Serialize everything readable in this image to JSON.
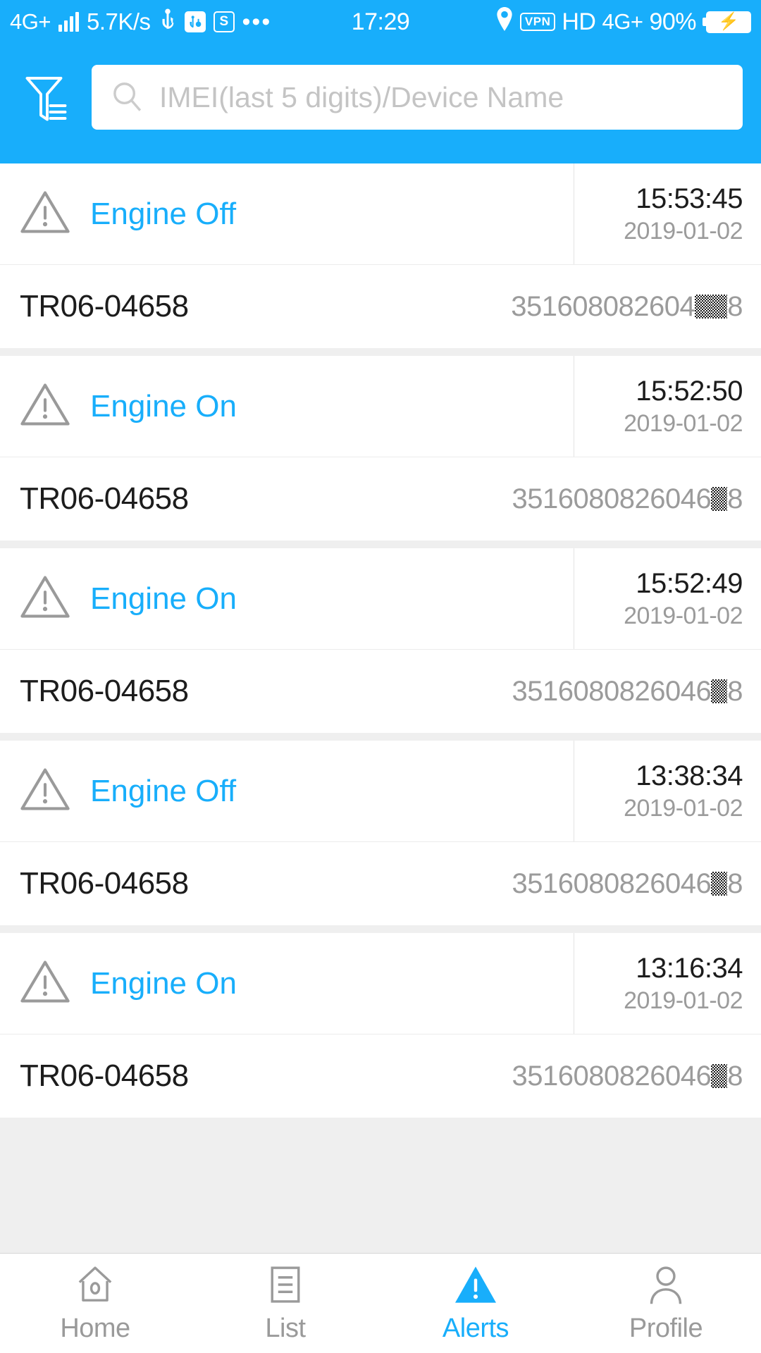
{
  "status_bar": {
    "network_type": "4G+",
    "signal_icon": "signal-bars-icon",
    "data_speed": "5.7K/s",
    "usb_icon": "usb-icon",
    "usb_debug_icon": "usb-debug-icon",
    "s_app_icon": "S",
    "more_icon": "•••",
    "clock": "17:29",
    "location_icon": "location-pin-icon",
    "vpn_badge": "VPN",
    "hd_label": "HD",
    "network_type_right": "4G+",
    "battery_percent": "90%",
    "battery_icon": "battery-charging-icon",
    "accent": "#18AEFB"
  },
  "header": {
    "filter_icon": "filter-funnel-icon",
    "search": {
      "icon": "search-icon",
      "placeholder": "IMEI(last 5 digits)/Device Name",
      "value": ""
    }
  },
  "alerts": [
    {
      "icon": "warning-triangle-icon",
      "type": "Engine Off",
      "time": "15:53:45",
      "date": "2019-01-02",
      "device_name": "TR06-04658",
      "imei_prefix": "351608082604",
      "imei_redacted_count": 2,
      "imei_suffix": "8"
    },
    {
      "icon": "warning-triangle-icon",
      "type": "Engine On",
      "time": "15:52:50",
      "date": "2019-01-02",
      "device_name": "TR06-04658",
      "imei_prefix": "3516080826046",
      "imei_redacted_count": 1,
      "imei_suffix": "8"
    },
    {
      "icon": "warning-triangle-icon",
      "type": "Engine On",
      "time": "15:52:49",
      "date": "2019-01-02",
      "device_name": "TR06-04658",
      "imei_prefix": "3516080826046",
      "imei_redacted_count": 1,
      "imei_suffix": "8"
    },
    {
      "icon": "warning-triangle-icon",
      "type": "Engine Off",
      "time": "13:38:34",
      "date": "2019-01-02",
      "device_name": "TR06-04658",
      "imei_prefix": "3516080826046",
      "imei_redacted_count": 1,
      "imei_suffix": "8"
    },
    {
      "icon": "warning-triangle-icon",
      "type": "Engine On",
      "time": "13:16:34",
      "date": "2019-01-02",
      "device_name": "TR06-04658",
      "imei_prefix": "3516080826046",
      "imei_redacted_count": 1,
      "imei_suffix": "8"
    }
  ],
  "tabbar": {
    "active": "Alerts",
    "items": [
      {
        "label": "Home",
        "icon": "home-icon"
      },
      {
        "label": "List",
        "icon": "list-icon"
      },
      {
        "label": "Alerts",
        "icon": "alert-triangle-filled-icon"
      },
      {
        "label": "Profile",
        "icon": "person-icon"
      }
    ],
    "active_color": "#18AEFB",
    "inactive_color": "#9a9a9a"
  }
}
